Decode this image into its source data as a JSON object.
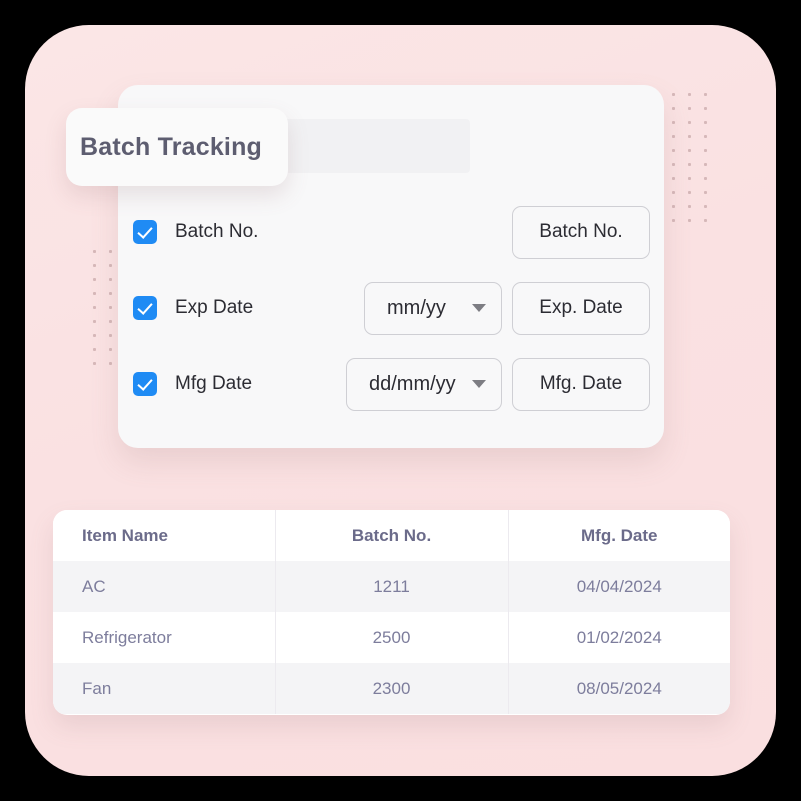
{
  "card": {
    "title": "Batch Tracking"
  },
  "form": {
    "rows": [
      {
        "checkbox_label": "Batch No.",
        "checked": true,
        "select": null,
        "input_value": "Batch No."
      },
      {
        "checkbox_label": "Exp Date",
        "checked": true,
        "select": "mm/yy",
        "input_value": "Exp. Date"
      },
      {
        "checkbox_label": "Mfg Date",
        "checked": true,
        "select": "dd/mm/yy",
        "input_value": "Mfg. Date"
      }
    ]
  },
  "table": {
    "columns": [
      "Item Name",
      "Batch No.",
      "Mfg. Date"
    ],
    "rows": [
      {
        "item": "AC",
        "batch": "1211",
        "mfg": "04/04/2024"
      },
      {
        "item": "Refrigerator",
        "batch": "2500",
        "mfg": "01/02/2024"
      },
      {
        "item": "Fan",
        "batch": "2300",
        "mfg": "08/05/2024"
      }
    ]
  },
  "colors": {
    "checkbox_blue": "#1f8bf4",
    "panel_pink": "#fae1e2",
    "title_text": "#5d5d70",
    "table_header_text": "#6b6b8a",
    "table_cell_text": "#7d7d9c"
  }
}
